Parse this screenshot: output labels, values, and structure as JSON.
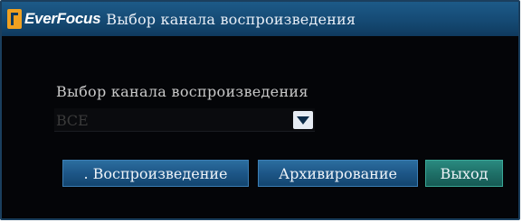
{
  "app": {
    "brand": "EverFocus",
    "title": "Выбор канала воспроизведения"
  },
  "form": {
    "label": "Выбор канала воспроизведения",
    "select_value": "ВСЕ"
  },
  "buttons": {
    "play_label": ". Воспроизведение",
    "archive_label": "Архивирование",
    "exit_label": "Выход"
  },
  "icons": {
    "logo": "everfocus-logo-icon",
    "dropdown": "chevron-down-icon"
  },
  "colors": {
    "background": "#040508",
    "titlebar": "#1d5a88",
    "button": "#1d5687",
    "exit_button": "#1f7068",
    "label_text": "#c9c9c9",
    "disabled_text": "#3a3a3a"
  }
}
